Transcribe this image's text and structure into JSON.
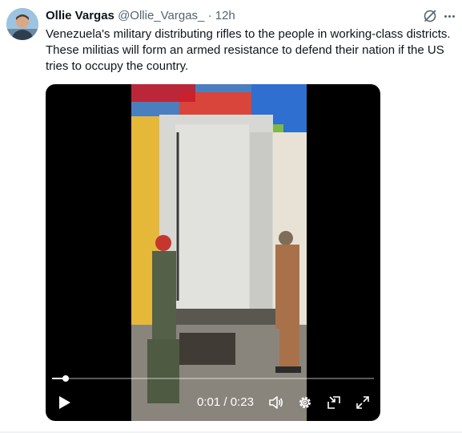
{
  "post": {
    "author_name": "Ollie Vargas",
    "handle": "@Ollie_Vargas_",
    "separator": "·",
    "time": "12h",
    "text": "Venezuela's military distributing rifles to the people in working-class districts. These militias will form an armed resistance to defend their nation if the US tries to occupy the country."
  },
  "video": {
    "current_time": "0:01",
    "duration": "0:23",
    "time_separator": "/",
    "progress": 0.043
  },
  "icons": {
    "grok": "grok-icon",
    "more": "more-icon",
    "play": "play-icon",
    "volume": "volume-icon",
    "settings": "settings-gear-icon",
    "picture_in_picture": "picture-in-picture-icon",
    "fullscreen": "fullscreen-icon"
  },
  "colors": {
    "text_primary": "#0f1419",
    "text_secondary": "#536471",
    "video_bg": "#000000"
  }
}
